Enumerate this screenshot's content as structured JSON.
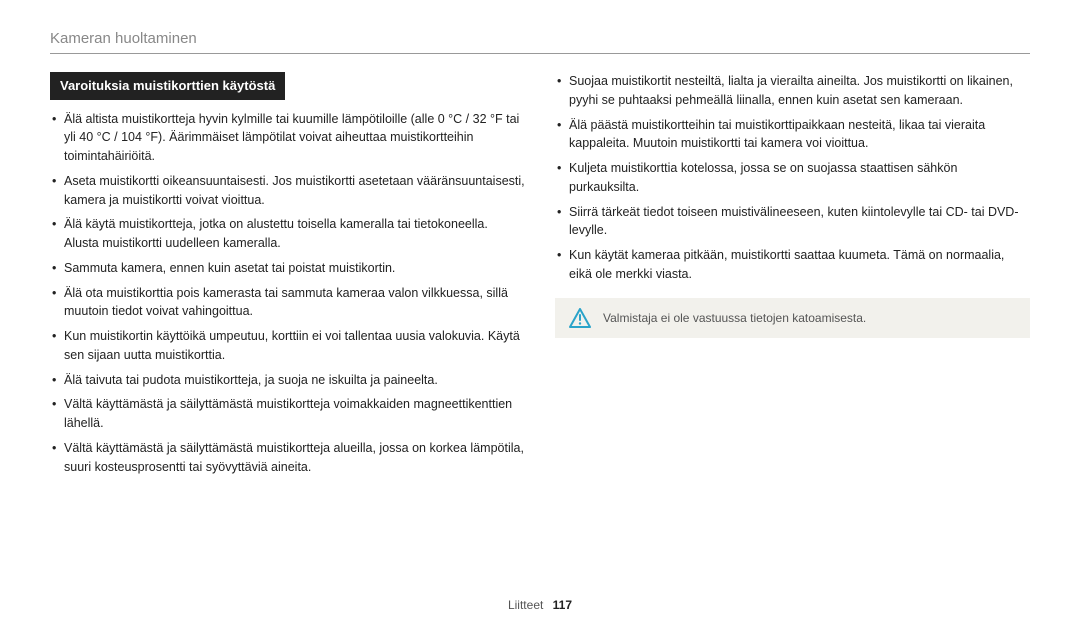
{
  "header": "Kameran huoltaminen",
  "section_title": "Varoituksia muistikorttien käytöstä",
  "left_bullets": [
    "Älä altista muistikortteja hyvin kylmille tai kuumille lämpötiloille (alle 0 °C / 32 °F tai yli 40 °C / 104 °F). Äärimmäiset lämpötilat voivat aiheuttaa muistikortteihin toimintahäiriöitä.",
    "Aseta muistikortti oikeansuuntaisesti. Jos muistikortti asetetaan vääränsuuntaisesti, kamera ja muistikortti voivat vioittua.",
    "Älä käytä muistikortteja, jotka on alustettu toisella kameralla tai tietokoneella. Alusta muistikortti uudelleen kameralla.",
    "Sammuta kamera, ennen kuin asetat tai poistat muistikortin.",
    "Älä ota muistikorttia pois kamerasta tai sammuta kameraa valon vilkkuessa, sillä muutoin tiedot voivat vahingoittua.",
    "Kun muistikortin käyttöikä umpeutuu, korttiin ei voi tallentaa uusia valokuvia. Käytä sen sijaan uutta muistikorttia.",
    "Älä taivuta tai pudota muistikortteja, ja suoja ne iskuilta ja paineelta.",
    "Vältä käyttämästä ja säilyttämästä muistikortteja voimakkaiden magneettikenttien lähellä.",
    "Vältä käyttämästä ja säilyttämästä muistikortteja alueilla, jossa on korkea lämpötila, suuri kosteusprosentti tai syövyttäviä aineita."
  ],
  "right_bullets": [
    "Suojaa muistikortit nesteiltä, lialta ja vierailta aineilta. Jos muistikortti on likainen, pyyhi se puhtaaksi pehmeällä liinalla, ennen kuin asetat sen kameraan.",
    "Älä päästä muistikortteihin tai muistikorttipaikkaan nesteitä, likaa tai vieraita kappaleita. Muutoin muistikortti tai kamera voi vioittua.",
    "Kuljeta muistikorttia kotelossa, jossa se on suojassa staattisen sähkön purkauksilta.",
    "Siirrä tärkeät tiedot toiseen muistivälineeseen, kuten kiintolevylle tai CD- tai DVD-levylle.",
    "Kun käytät kameraa pitkään, muistikortti saattaa kuumeta. Tämä on normaalia, eikä ole merkki viasta."
  ],
  "note_text": "Valmistaja ei ole vastuussa tietojen katoamisesta.",
  "footer_label": "Liitteet",
  "footer_page": "117"
}
